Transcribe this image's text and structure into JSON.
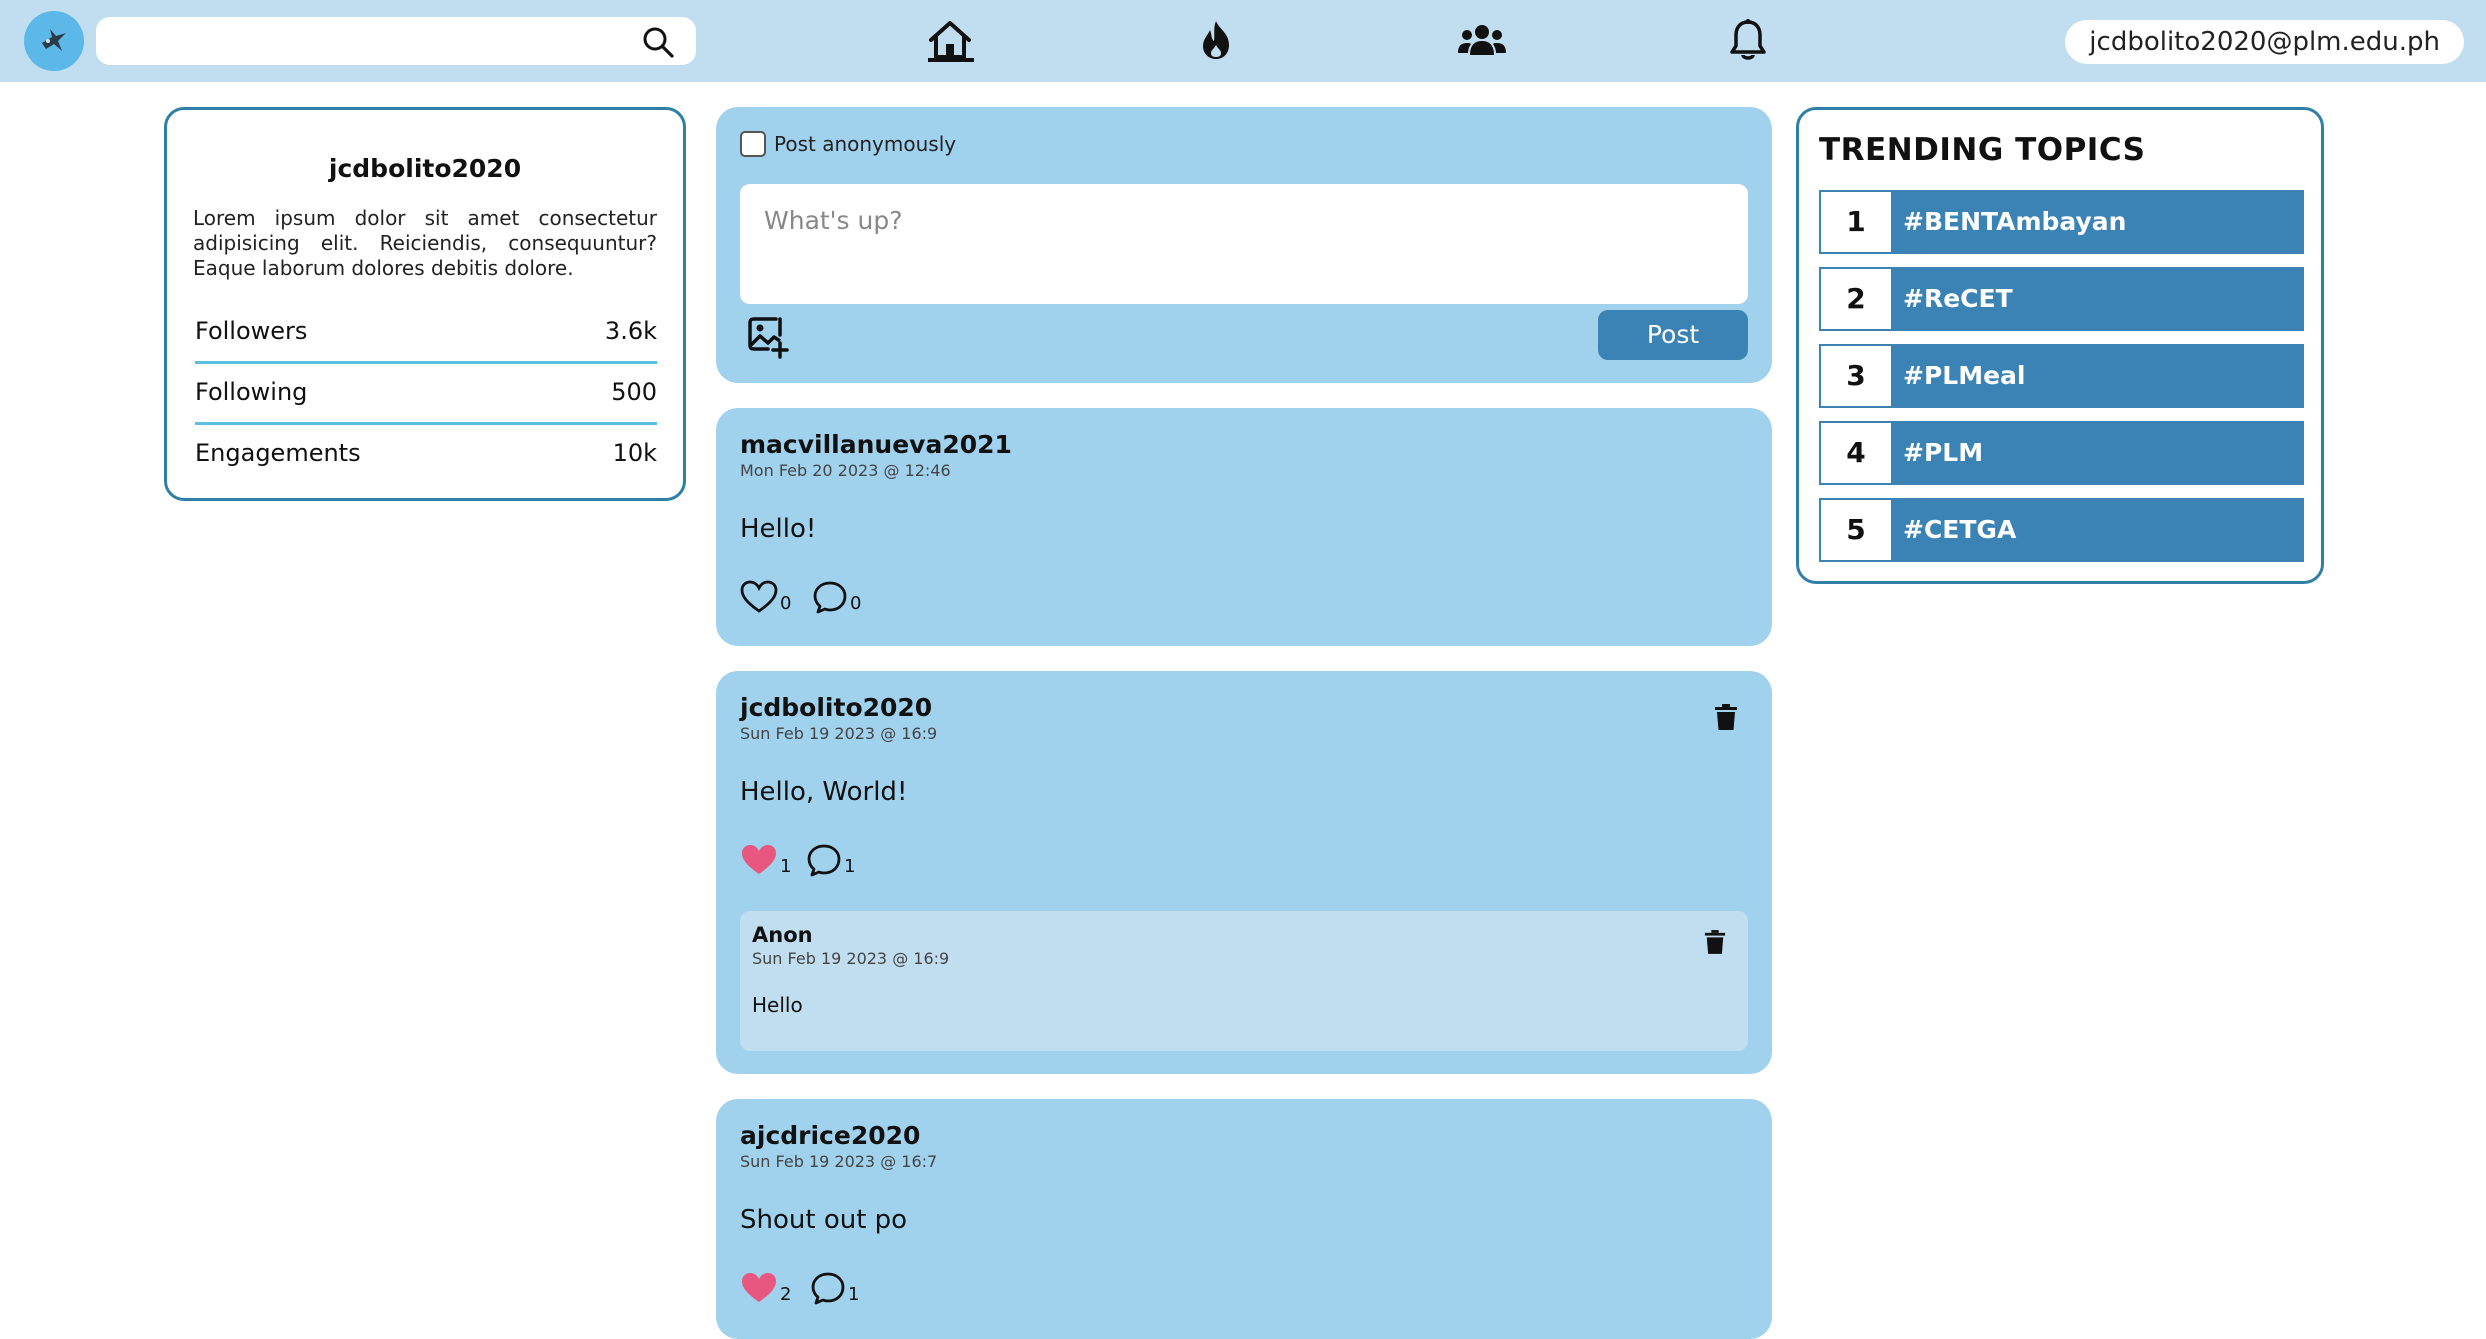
{
  "header": {
    "search_placeholder": "",
    "email": "jcdbolito2020@plm.edu.ph"
  },
  "profile": {
    "username": "jcdbolito2020",
    "bio": "Lorem ipsum dolor sit amet consectetur adipisicing elit. Reiciendis, consequuntur? Eaque laborum dolores debitis dolore.",
    "stats": [
      {
        "label": "Followers",
        "value": "3.6k"
      },
      {
        "label": "Following",
        "value": "500"
      },
      {
        "label": "Engagements",
        "value": "10k"
      }
    ]
  },
  "composer": {
    "anon_label": "Post anonymously",
    "placeholder": "What's up?",
    "post_label": "Post"
  },
  "posts": [
    {
      "author": "macvillanueva2021",
      "time": "Mon Feb 20 2023 @ 12:46",
      "body": "Hello!",
      "likes": "0",
      "comments": "0"
    },
    {
      "author": "jcdbolito2020",
      "time": "Sun Feb 19 2023 @ 16:9",
      "body": "Hello, World!",
      "likes": "1",
      "comments": "1",
      "reply": {
        "author": "Anon",
        "time": "Sun Feb 19 2023 @ 16:9",
        "body": "Hello"
      }
    },
    {
      "author": "ajcdrice2020",
      "time": "Sun Feb 19 2023 @ 16:7",
      "body": "Shout out po",
      "likes": "2",
      "comments": "1"
    }
  ],
  "trending": {
    "title": "TRENDING TOPICS",
    "topics": [
      {
        "rank": "1",
        "tag": "#BENTAmbayan"
      },
      {
        "rank": "2",
        "tag": "#ReCET"
      },
      {
        "rank": "3",
        "tag": "#PLMeal"
      },
      {
        "rank": "4",
        "tag": "#PLM"
      },
      {
        "rank": "5",
        "tag": "#CETGA"
      }
    ]
  },
  "colors": {
    "topbar": "#c1def0",
    "card": "#a0d2ee",
    "accent": "#3a83b4",
    "liked": "#e8577f"
  }
}
